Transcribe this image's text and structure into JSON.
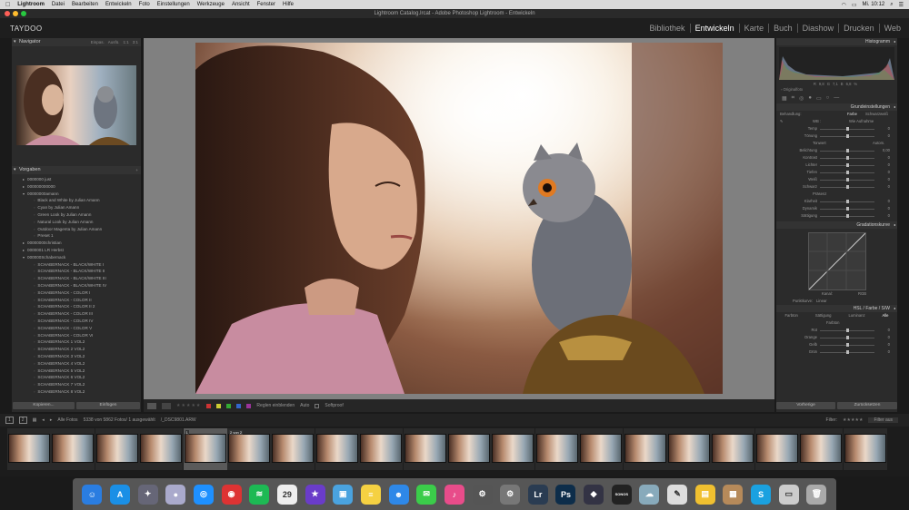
{
  "menubar": {
    "app": "Lightroom",
    "items": [
      "Datei",
      "Bearbeiten",
      "Entwickeln",
      "Foto",
      "Einstellungen",
      "Werkzeuge",
      "Ansicht",
      "Fenster",
      "Hilfe"
    ],
    "time": "Mi. 10:12"
  },
  "window": {
    "title": "Lightroom Catalog.lrcat - Adobe Photoshop Lightroom - Entwickeln"
  },
  "identity": {
    "brand": "TAYDOO"
  },
  "modules": [
    {
      "label": "Bibliothek",
      "active": false
    },
    {
      "label": "Entwickeln",
      "active": true
    },
    {
      "label": "Karte",
      "active": false
    },
    {
      "label": "Buch",
      "active": false
    },
    {
      "label": "Diashow",
      "active": false
    },
    {
      "label": "Drucken",
      "active": false
    },
    {
      "label": "Web",
      "active": false
    }
  ],
  "navigator": {
    "title": "Navigator",
    "options": [
      "Einpas.",
      "Ausfü.",
      "1:1",
      "3:1"
    ]
  },
  "presets": {
    "title": "Vorgaben",
    "items": [
      {
        "label": "0000000 just",
        "type": "folder"
      },
      {
        "label": "000000000000",
        "type": "folder"
      },
      {
        "label": "00000000amann",
        "type": "folder-open"
      },
      {
        "label": "Black and White by Julian Amann",
        "type": "preset"
      },
      {
        "label": "Cyan by Julian Amann",
        "type": "preset"
      },
      {
        "label": "Green Look by Julian Amann",
        "type": "preset"
      },
      {
        "label": "Natural Look by Julian Amann",
        "type": "preset"
      },
      {
        "label": "Outdoor Magenta by Julian Amann",
        "type": "preset"
      },
      {
        "label": "Preset 1",
        "type": "preset"
      },
      {
        "label": "00000000christian",
        "type": "folder"
      },
      {
        "label": "0000001 LR Herbst",
        "type": "folder"
      },
      {
        "label": "000000Schabernack",
        "type": "folder-open"
      },
      {
        "label": "SCHABERNACK - BLACK/WHITE I",
        "type": "preset"
      },
      {
        "label": "SCHABERNACK - BLACK/WHITE II",
        "type": "preset"
      },
      {
        "label": "SCHABERNACK - BLACK/WHITE III",
        "type": "preset"
      },
      {
        "label": "SCHABERNACK - BLACK/WHITE IV",
        "type": "preset"
      },
      {
        "label": "SCHABERNACK - COLOR I",
        "type": "preset"
      },
      {
        "label": "SCHABERNACK - COLOR II",
        "type": "preset"
      },
      {
        "label": "SCHABERNACK - COLOR II 2",
        "type": "preset"
      },
      {
        "label": "SCHABERNACK - COLOR III",
        "type": "preset"
      },
      {
        "label": "SCHABERNACK - COLOR IV",
        "type": "preset"
      },
      {
        "label": "SCHABERNACK - COLOR V",
        "type": "preset"
      },
      {
        "label": "SCHABERNACK - COLOR VI",
        "type": "preset"
      },
      {
        "label": "SCHABERNACK 1 VOL2",
        "type": "preset"
      },
      {
        "label": "SCHABERNACK 2 VOL2",
        "type": "preset"
      },
      {
        "label": "SCHABERNACK 3 VOL2",
        "type": "preset"
      },
      {
        "label": "SCHABERNACK 4 VOL2",
        "type": "preset"
      },
      {
        "label": "SCHABERNACK 5 VOL2",
        "type": "preset"
      },
      {
        "label": "SCHABERNACK 6 VOL2",
        "type": "preset"
      },
      {
        "label": "SCHABERNACK 7 VOL2",
        "type": "preset"
      },
      {
        "label": "SCHABERNACK 8 VOL2",
        "type": "preset"
      }
    ]
  },
  "left_buttons": {
    "copy": "Kopieren...",
    "paste": "Einfügen"
  },
  "toolbar": {
    "softproof": "Softproof",
    "reveal": "Reglen einblenden",
    "auto": "Auto"
  },
  "histogram": {
    "title": "Histogramm",
    "readout": [
      "R",
      "9,8",
      "G",
      "7,1",
      "B",
      "6,8",
      "%"
    ],
    "original": "Originalfoto"
  },
  "basic": {
    "title": "Grundeinstellungen",
    "treatment_label": "Behandlung:",
    "treatment_color": "Farbe",
    "treatment_bw": "Schwarzweiß",
    "wb_label": "WB :",
    "wb_value": "Wie Aufnahme",
    "tone_label": "Tonwert",
    "auto": "Autom.",
    "presence": "Präsenz",
    "sliders_wb": [
      {
        "label": "Temp",
        "value": "0",
        "pos": 0.5
      },
      {
        "label": "Tönung",
        "value": "0",
        "pos": 0.5
      }
    ],
    "sliders_tone": [
      {
        "label": "Belichtung",
        "value": "0,00",
        "pos": 0.5
      },
      {
        "label": "Kontrast",
        "value": "0",
        "pos": 0.5
      },
      {
        "label": "Lichter",
        "value": "0",
        "pos": 0.5
      },
      {
        "label": "Tiefen",
        "value": "0",
        "pos": 0.5
      },
      {
        "label": "Weiß",
        "value": "0",
        "pos": 0.5
      },
      {
        "label": "Schwarz",
        "value": "0",
        "pos": 0.5
      }
    ],
    "sliders_presence": [
      {
        "label": "Klarheit",
        "value": "0",
        "pos": 0.5
      },
      {
        "label": "Dynamik",
        "value": "0",
        "pos": 0.5
      },
      {
        "label": "Sättigung",
        "value": "0",
        "pos": 0.5
      }
    ]
  },
  "tonecurve": {
    "title": "Gradationskurve",
    "channel_label": "Kanal:",
    "channel": "RGB",
    "point_curve_label": "Punktkurve:",
    "point_curve": "Linear"
  },
  "hsl": {
    "title": "HSL / Farbe / S/W",
    "tabs": [
      "Farbton",
      "Sättigung",
      "Luminanz",
      "Alle"
    ],
    "active": "Alle",
    "sub": "Farbton",
    "sliders": [
      {
        "label": "Rot",
        "value": "0",
        "pos": 0.5
      },
      {
        "label": "Orange",
        "value": "0",
        "pos": 0.5
      },
      {
        "label": "Gelb",
        "value": "0",
        "pos": 0.5
      },
      {
        "label": "Grün",
        "value": "0",
        "pos": 0.5
      }
    ]
  },
  "right_buttons": {
    "previous": "Vorherige",
    "reset": "Zurücksetzen"
  },
  "filmbar": {
    "source": "Alle Fotos",
    "count": "5338 von 5862 Fotos/ 1 ausgewählt",
    "file": "/_DSC9801.ARW",
    "filter": "Filter:",
    "filter_value": "Filter aus"
  },
  "filmstrip": {
    "count": 20,
    "selected_index": 4,
    "badges": [
      {
        "index": 4,
        "text": "1"
      },
      {
        "index": 5,
        "text": "2 von 2"
      }
    ]
  },
  "dock": [
    {
      "name": "finder",
      "color": "#2a7de1",
      "glyph": "☺"
    },
    {
      "name": "app-store",
      "color": "#1a8fe6",
      "glyph": "A"
    },
    {
      "name": "launchpad",
      "color": "#667",
      "glyph": "✦"
    },
    {
      "name": "migration",
      "color": "#aac",
      "glyph": "●"
    },
    {
      "name": "safari",
      "color": "#1e90ff",
      "glyph": "◎"
    },
    {
      "name": "chrome",
      "color": "#d33",
      "glyph": "◉"
    },
    {
      "name": "spotify",
      "color": "#1db954",
      "glyph": "≋"
    },
    {
      "name": "calendar",
      "color": "#eee",
      "glyph": "29"
    },
    {
      "name": "imovie",
      "color": "#6a3cc9",
      "glyph": "★"
    },
    {
      "name": "preview",
      "color": "#4aa3df",
      "glyph": "▣"
    },
    {
      "name": "notes",
      "color": "#f5d142",
      "glyph": "≡"
    },
    {
      "name": "finder-window",
      "color": "#2e88e8",
      "glyph": "☻"
    },
    {
      "name": "messages",
      "color": "#3bcc4a",
      "glyph": "✉"
    },
    {
      "name": "itunes",
      "color": "#e84c8a",
      "glyph": "♪"
    },
    {
      "name": "utility",
      "color": "#555",
      "glyph": "⚙"
    },
    {
      "name": "system-prefs",
      "color": "#777",
      "glyph": "⚙"
    },
    {
      "name": "lightroom",
      "color": "#2a3c52",
      "glyph": "Lr"
    },
    {
      "name": "photoshop",
      "color": "#0d2d4a",
      "glyph": "Ps"
    },
    {
      "name": "camera-app",
      "color": "#334",
      "glyph": "◆"
    },
    {
      "name": "sonos",
      "color": "#222",
      "glyph": "SONOS"
    },
    {
      "name": "cloud",
      "color": "#8ab",
      "glyph": "☁"
    },
    {
      "name": "textedit",
      "color": "#ddd",
      "glyph": "✎"
    },
    {
      "name": "stickies",
      "color": "#f0c030",
      "glyph": "▤"
    },
    {
      "name": "photos-folder",
      "color": "#b68a5a",
      "glyph": "▦"
    },
    {
      "name": "skype",
      "color": "#1aa1e0",
      "glyph": "S"
    },
    {
      "name": "docs",
      "color": "#ccc",
      "glyph": "▭"
    },
    {
      "name": "trash",
      "color": "#aaa",
      "glyph": "🗑"
    }
  ]
}
